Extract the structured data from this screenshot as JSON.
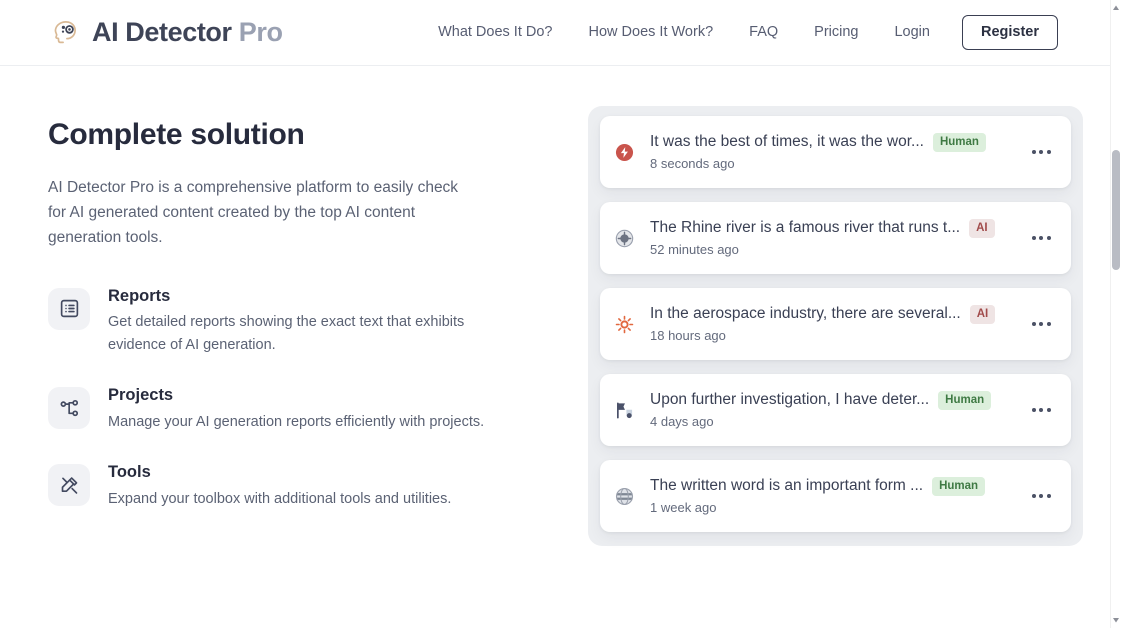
{
  "header": {
    "brand": {
      "icon": "brain-head-icon",
      "name_primary": "AI Detector",
      "name_secondary": "Pro"
    },
    "nav": [
      {
        "label": "What Does It Do?",
        "name": "nav-what-does-it-do"
      },
      {
        "label": "How Does It Work?",
        "name": "nav-how-does-it-work"
      },
      {
        "label": "FAQ",
        "name": "nav-faq"
      },
      {
        "label": "Pricing",
        "name": "nav-pricing"
      },
      {
        "label": "Login",
        "name": "nav-login"
      }
    ],
    "register_label": "Register"
  },
  "main": {
    "title": "Complete solution",
    "description": "AI Detector Pro is a comprehensive platform to easily check for AI generated content created by the top AI content generation tools.",
    "features": [
      {
        "icon": "report-list-icon",
        "title": "Reports",
        "description": "Get detailed reports showing the exact text that exhibits evidence of AI generation."
      },
      {
        "icon": "hierarchy-sitemap-icon",
        "title": "Projects",
        "description": "Manage your AI generation reports efficiently with projects."
      },
      {
        "icon": "hammer-wrench-icon",
        "title": "Tools",
        "description": "Expand your toolbox with additional tools and utilities."
      }
    ]
  },
  "documents": [
    {
      "favicon": "red-lightning-bolt-icon",
      "title": "It was the best of times, it was the wor...",
      "badge": "Human",
      "badge_type": "human",
      "time": "8 seconds ago",
      "menu": "more-options-icon"
    },
    {
      "favicon": "gray-compass-icon",
      "title": "The Rhine river is a famous river that runs t...",
      "badge": "AI",
      "badge_type": "ai",
      "time": "52 minutes ago",
      "menu": "more-options-icon"
    },
    {
      "favicon": "orange-sun-burst-icon",
      "title": "In the aerospace industry, there are several...",
      "badge": "AI",
      "badge_type": "ai",
      "time": "18 hours ago",
      "menu": "more-options-icon"
    },
    {
      "favicon": "blue-flag-dot-icon",
      "title": "Upon further investigation, I have deter...",
      "badge": "Human",
      "badge_type": "human",
      "time": "4 days ago",
      "menu": "more-options-icon"
    },
    {
      "favicon": "gray-globe-icon",
      "title": "The written word is an important form ...",
      "badge": "Human",
      "badge_type": "human",
      "time": "1 week ago",
      "menu": "more-options-icon"
    }
  ],
  "colors": {
    "brand_dark": "#3e4457",
    "brand_muted": "#9aa1b2",
    "text_heading": "#272b3d",
    "text_body": "#5b6274",
    "panel_bg": "#eceef1",
    "badge_human_bg": "#dcefdc",
    "badge_human_fg": "#3f7a44",
    "badge_ai_bg": "#efe4e4",
    "badge_ai_fg": "#a14b4b",
    "logo_outline": "#d7b894"
  }
}
